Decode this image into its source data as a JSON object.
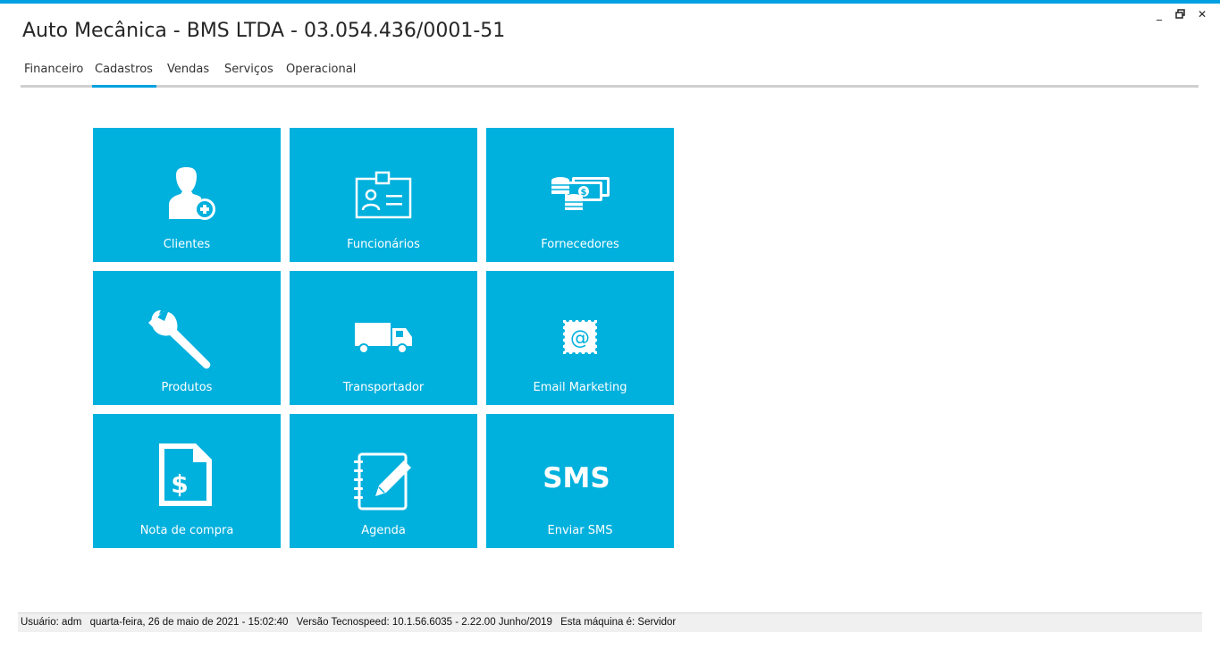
{
  "window": {
    "title": "Auto Mecânica - BMS LTDA - 03.054.436/0001-51",
    "minimize_glyph": "_",
    "restore_glyph": "🗗",
    "close_glyph": "✕"
  },
  "tabs": [
    {
      "label": "Financeiro",
      "active": false
    },
    {
      "label": "Cadastros",
      "active": true
    },
    {
      "label": "Vendas",
      "active": false
    },
    {
      "label": "Serviços",
      "active": false
    },
    {
      "label": "Operacional",
      "active": false
    }
  ],
  "tiles": [
    {
      "label": "Clientes",
      "icon": "add-user-icon"
    },
    {
      "label": "Funcionários",
      "icon": "id-badge-icon"
    },
    {
      "label": "Fornecedores",
      "icon": "money-stack-icon"
    },
    {
      "label": "Produtos",
      "icon": "wrench-icon"
    },
    {
      "label": "Transportador",
      "icon": "truck-icon"
    },
    {
      "label": "Email Marketing",
      "icon": "email-stamp-icon"
    },
    {
      "label": "Nota de compra",
      "icon": "invoice-dollar-icon"
    },
    {
      "label": "Agenda",
      "icon": "notebook-pen-icon"
    },
    {
      "label": "Enviar SMS",
      "icon": "sms-icon",
      "icon_text": "SMS"
    }
  ],
  "status": {
    "user": "Usuário: adm",
    "datetime": "quarta-feira, 26 de maio de 2021 - 15:02:40",
    "version": "Versão Tecnospeed:  10.1.56.6035 - 2.22.00 Junho/2019",
    "machine": "Esta máquina é: Servidor"
  },
  "colors": {
    "accent": "#00a1e0",
    "tile": "#00b0dd",
    "tab_underline": "#cfcfcf"
  }
}
